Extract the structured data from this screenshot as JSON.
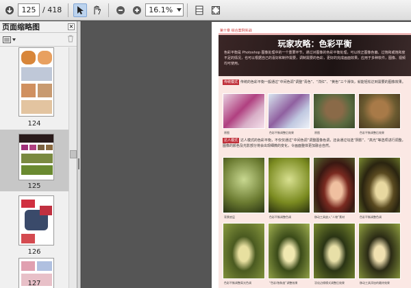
{
  "toolbar": {
    "page_value": "125",
    "page_total": "/ 418",
    "zoom_value": "16.1%"
  },
  "panel": {
    "title": "页面缩略图",
    "close_glyph": "×",
    "thumbnails": [
      {
        "label": "124"
      },
      {
        "label": "125"
      },
      {
        "label": "126"
      },
      {
        "label": "127"
      }
    ]
  },
  "page": {
    "header_rule": "第十章 综合案例实战",
    "title": "玩家攻略：色彩平衡",
    "intro": "色彩平衡是 Photoshop 图像处理中的一个重要环节，通过对图像的色彩平衡处理，可以校正图像色偏、过饱和或饱和度不足的情况，也可以根据自己的喜好和制作需要，调制需要的色彩，更好的完成画面效果。应用于多种软件，图像、视频均可使用。",
    "section1_tag": "传统模式",
    "section1_text": "传统的色彩平衡一般通过“中间色调”调整“青色”、“洋红”、“黄色”三个滑块，就能轻松达到需要的图像效果。",
    "section1_captions": [
      "原图",
      "色彩平衡调整后效果",
      "原图",
      "色彩平衡调整后效果"
    ],
    "section2_tag": "达人模式",
    "section2_text": "达人模式的色彩平衡，不仅仅通过“中间色调”调整图像色调，还会通过勾选“阴影”、“高光”等选项进行调整，图像的颜色及光影部分将会出现细微的变化，令画面整体更加融合自然。",
    "section2_captions": [
      "背景底层",
      "色彩平衡调整色调",
      "移动工具放入“人物”素材",
      "色彩平衡调整色调"
    ],
    "section3_captions": [
      "色彩平衡调整高光色调",
      "“色彩/饱和度”调整效果",
      "羽化边缘模式调整后效果",
      "移动工具添加的最终效果"
    ]
  },
  "colors": {
    "accent": "#c0303a",
    "hero_bg": "#2a1b1b",
    "page_tint": "#fbe8e4",
    "selection": "#c7c7c7"
  }
}
